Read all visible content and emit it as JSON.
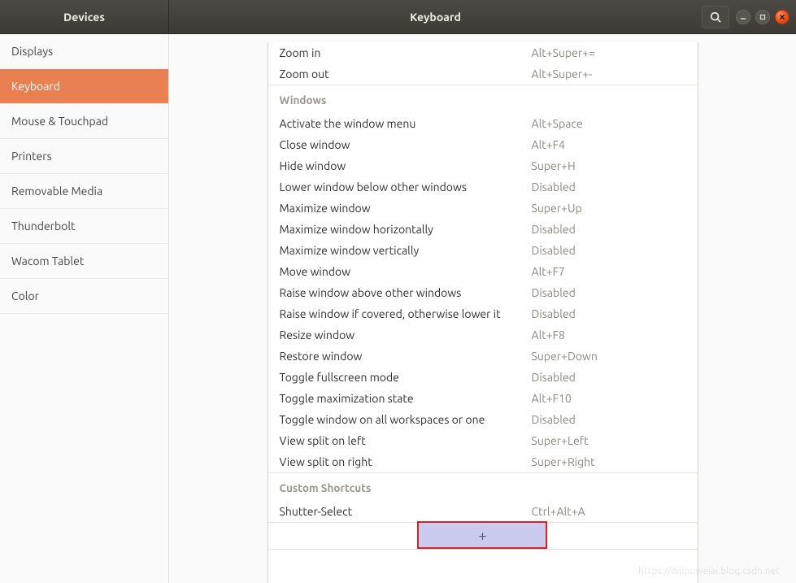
{
  "header": {
    "devices": "Devices",
    "title": "Keyboard"
  },
  "sidebar": {
    "items": [
      {
        "label": "Displays"
      },
      {
        "label": "Keyboard"
      },
      {
        "label": "Mouse & Touchpad"
      },
      {
        "label": "Printers"
      },
      {
        "label": "Removable Media"
      },
      {
        "label": "Thunderbolt"
      },
      {
        "label": "Wacom Tablet"
      },
      {
        "label": "Color"
      }
    ],
    "active_index": 1
  },
  "shortcuts": {
    "zoom": [
      {
        "label": "Zoom in",
        "value": "Alt+Super+="
      },
      {
        "label": "Zoom out",
        "value": "Alt+Super+-"
      }
    ],
    "windows_heading": "Windows",
    "windows": [
      {
        "label": "Activate the window menu",
        "value": "Alt+Space"
      },
      {
        "label": "Close window",
        "value": "Alt+F4"
      },
      {
        "label": "Hide window",
        "value": "Super+H"
      },
      {
        "label": "Lower window below other windows",
        "value": "Disabled"
      },
      {
        "label": "Maximize window",
        "value": "Super+Up"
      },
      {
        "label": "Maximize window horizontally",
        "value": "Disabled"
      },
      {
        "label": "Maximize window vertically",
        "value": "Disabled"
      },
      {
        "label": "Move window",
        "value": "Alt+F7"
      },
      {
        "label": "Raise window above other windows",
        "value": "Disabled"
      },
      {
        "label": "Raise window if covered, otherwise lower it",
        "value": "Disabled"
      },
      {
        "label": "Resize window",
        "value": "Alt+F8"
      },
      {
        "label": "Restore window",
        "value": "Super+Down"
      },
      {
        "label": "Toggle fullscreen mode",
        "value": "Disabled"
      },
      {
        "label": "Toggle maximization state",
        "value": "Alt+F10"
      },
      {
        "label": "Toggle window on all workspaces or one",
        "value": "Disabled"
      },
      {
        "label": "View split on left",
        "value": "Super+Left"
      },
      {
        "label": "View split on right",
        "value": "Super+Right"
      }
    ],
    "custom_heading": "Custom Shortcuts",
    "custom": [
      {
        "label": "Shutter-Select",
        "value": "Ctrl+Alt+A"
      }
    ],
    "add_label": "+"
  },
  "watermark": "https://daipuweiai.blog.csdn.net"
}
